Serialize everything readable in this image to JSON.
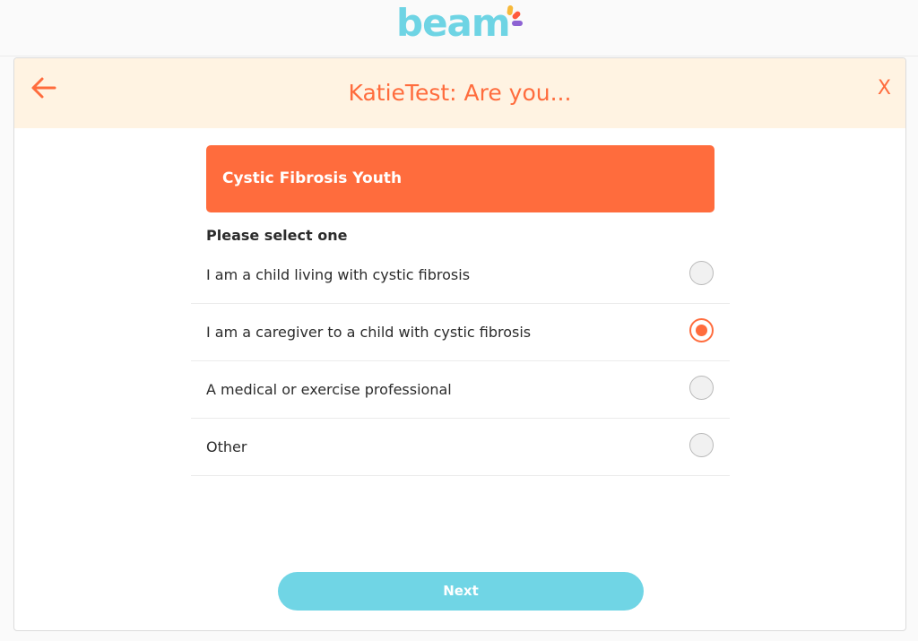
{
  "brand": {
    "logo_text": "beam"
  },
  "header": {
    "title": "KatieTest: Are you...",
    "close_label": "X"
  },
  "category": {
    "label": "Cystic Fibrosis Youth"
  },
  "prompt": "Please select one",
  "options": [
    {
      "label": "I am a child living with cystic fibrosis",
      "selected": false
    },
    {
      "label": "I am a caregiver to a child with cystic fibrosis",
      "selected": true
    },
    {
      "label": "A medical or exercise professional",
      "selected": false
    },
    {
      "label": "Other",
      "selected": false
    }
  ],
  "actions": {
    "next_label": "Next"
  },
  "colors": {
    "accent": "#ff6c3d",
    "header_bg": "#fff3e2",
    "brand_teal": "#70d5e5",
    "logo_yellow": "#f7b93a",
    "logo_red": "#ff5a3c",
    "logo_purple": "#8d62d3"
  },
  "icons": {
    "back": "arrow-left-icon",
    "close": "close-icon"
  }
}
